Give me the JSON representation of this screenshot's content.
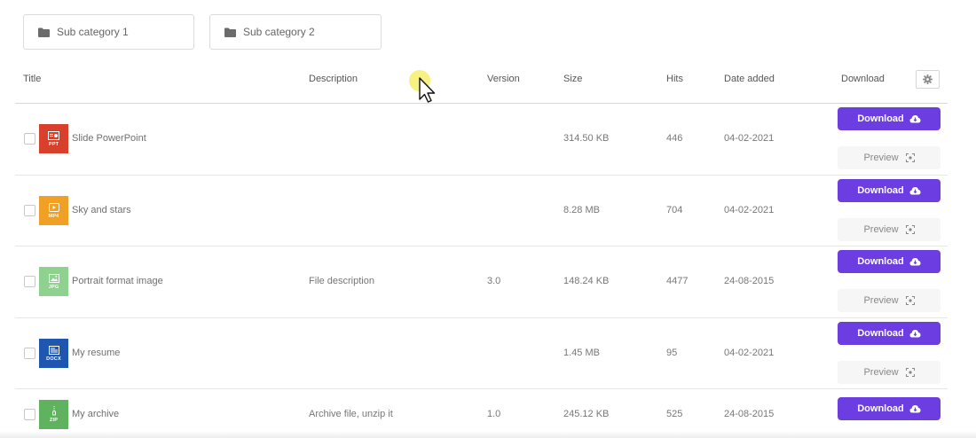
{
  "categories": [
    {
      "label": "Sub category 1",
      "icon": "folder-icon"
    },
    {
      "label": "Sub category 2",
      "icon": "folder-icon"
    }
  ],
  "table": {
    "columns": {
      "title": "Title",
      "description": "Description",
      "version": "Version",
      "size": "Size",
      "hits": "Hits",
      "date_added": "Date added",
      "download": "Download"
    },
    "settings_icon": "gear-icon",
    "rows": [
      {
        "title": "Slide PowerPoint",
        "description": "",
        "version": "",
        "size": "314.50 KB",
        "hits": "446",
        "date": "04-02-2021",
        "file_type": "PPT",
        "icon_color": "#d9402b"
      },
      {
        "title": "Sky and stars",
        "description": "",
        "version": "",
        "size": "8.28 MB",
        "hits": "704",
        "date": "04-02-2021",
        "file_type": "MP4",
        "icon_color": "#f0a024"
      },
      {
        "title": "Portrait format image",
        "description": "File description",
        "version": "3.0",
        "size": "148.24 KB",
        "hits": "4477",
        "date": "24-08-2015",
        "file_type": "JPG",
        "icon_color": "#8fd28f"
      },
      {
        "title": "My resume",
        "description": "",
        "version": "",
        "size": "1.45 MB",
        "hits": "95",
        "date": "04-02-2021",
        "file_type": "DOCX",
        "icon_color": "#1e56b0"
      },
      {
        "title": "My archive",
        "description": "Archive file, unzip it",
        "version": "1.0",
        "size": "245.12 KB",
        "hits": "525",
        "date": "24-08-2015",
        "file_type": "ZIP",
        "icon_color": "#5fb35f"
      }
    ]
  },
  "buttons": {
    "download_label": "Download",
    "download_icon": "cloud-download-icon",
    "preview_label": "Preview",
    "preview_icon": "preview-scan-icon",
    "download_color": "#6c3de0"
  }
}
